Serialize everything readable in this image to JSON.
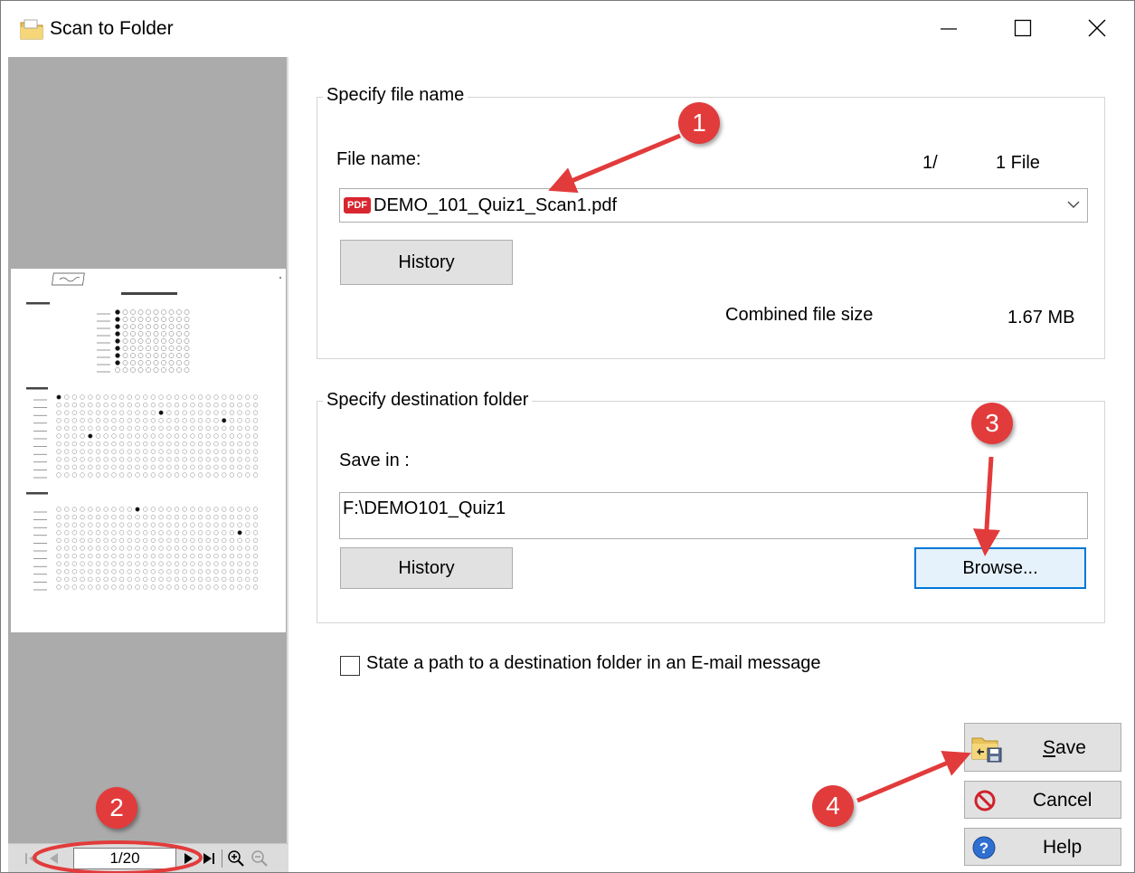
{
  "window": {
    "title": "Scan to Folder",
    "minimize_glyph": "—",
    "maximize_glyph": "☐",
    "close_glyph": "✕"
  },
  "preview": {
    "page_indicator": "1/20",
    "nav_icons": [
      "first-page-icon",
      "previous-page-icon",
      "next-page-icon",
      "last-page-icon",
      "zoom-in-icon",
      "zoom-out-icon"
    ]
  },
  "file_group": {
    "legend": "Specify file name",
    "file_name_label": "File name:",
    "file_index": "1/",
    "file_count": "1 File",
    "file_name_value": "DEMO_101_Quiz1_Scan1.pdf",
    "pdf_badge": "PDF",
    "history_label": "History",
    "combined_size_label": "Combined file size",
    "combined_size_value": "1.67 MB"
  },
  "dest_group": {
    "legend": "Specify destination folder",
    "save_in_label": "Save in :",
    "path_value": "F:\\DEMO101_Quiz1",
    "history_label": "History",
    "browse_label": "Browse..."
  },
  "email_option": {
    "label": "State a path to a destination folder in an E-mail message",
    "checked": false
  },
  "actions": {
    "save_label": "Save",
    "cancel_label": "Cancel",
    "help_label": "Help"
  },
  "annotations": {
    "badge_1": "1",
    "badge_2": "2",
    "badge_3": "3",
    "badge_4": "4",
    "color": "#e23b3b"
  }
}
